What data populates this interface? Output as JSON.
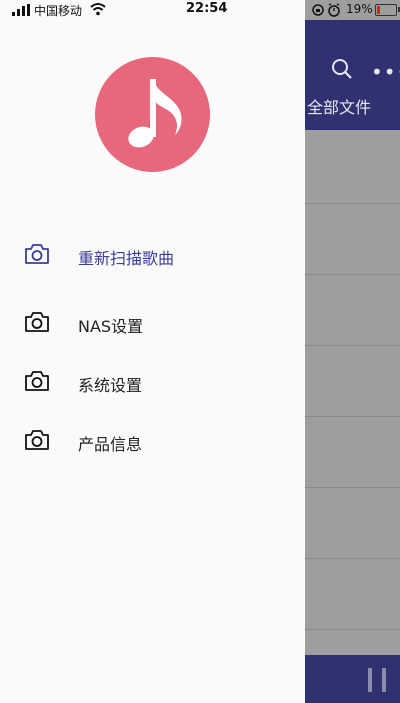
{
  "status_bar": {
    "carrier": "中国移动",
    "time": "22:54",
    "battery": "19%"
  },
  "drawer": {
    "menu": [
      {
        "label": "重新扫描歌曲",
        "icon": "camera-icon",
        "active": true
      },
      {
        "label": "NAS设置",
        "icon": "camera-icon",
        "active": false
      },
      {
        "label": "系统设置",
        "icon": "camera-icon",
        "active": false
      },
      {
        "label": "产品信息",
        "icon": "camera-icon",
        "active": false
      }
    ]
  },
  "background_app": {
    "tab_label": "全部文件"
  },
  "colors": {
    "accent": "#3a3f96",
    "header": "#2f3170",
    "avatar": "#e7677c",
    "battery_low": "#d8261c"
  }
}
